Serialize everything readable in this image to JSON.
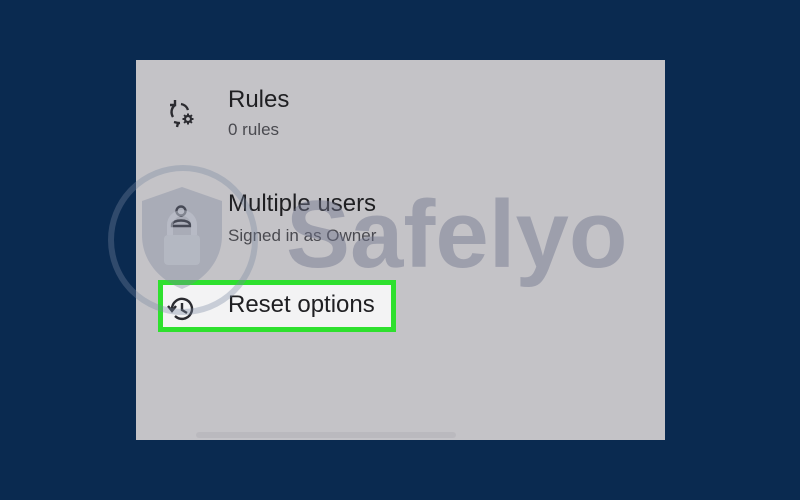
{
  "settings": {
    "items": [
      {
        "icon": "rules-icon",
        "title": "Rules",
        "subtitle": "0 rules"
      },
      {
        "icon": "person-icon",
        "title": "Multiple users",
        "subtitle": "Signed in as Owner"
      },
      {
        "icon": "history-icon",
        "title": "Reset options"
      }
    ],
    "highlight_color": "#2ee02e"
  },
  "watermark": {
    "text": "Safelyo",
    "icon": "shield-lock-icon"
  },
  "colors": {
    "background": "#0a2a50",
    "panel": "#c4c3c7"
  }
}
